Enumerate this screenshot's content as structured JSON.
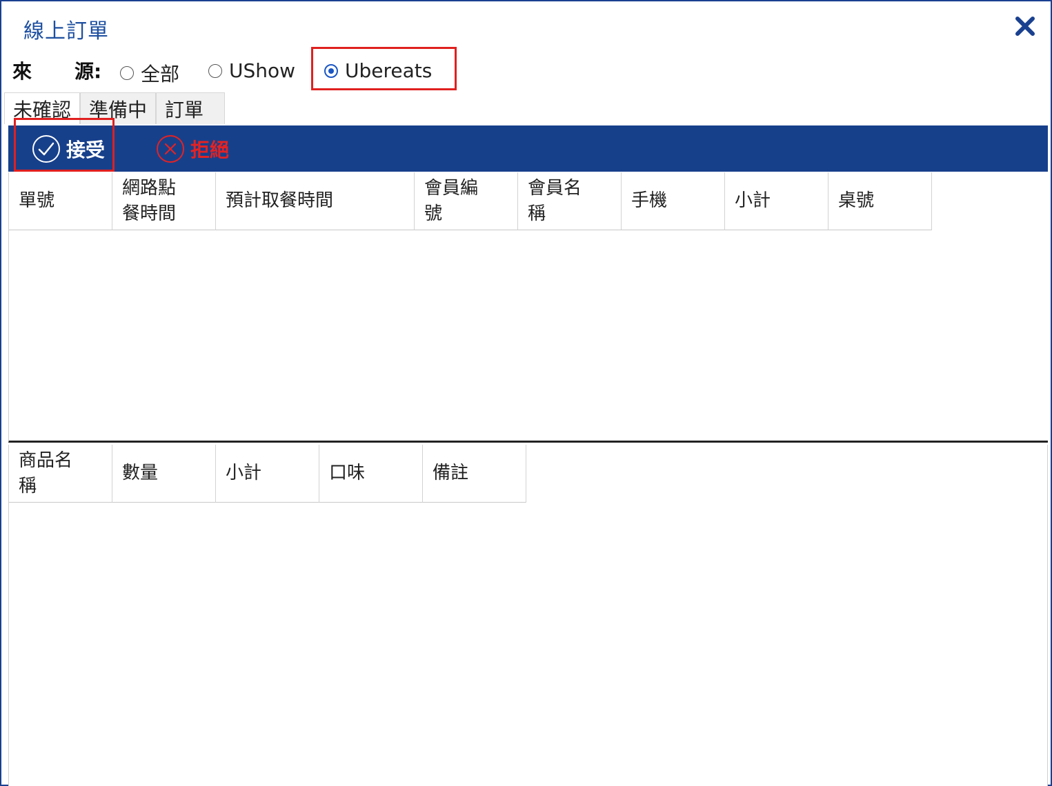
{
  "window": {
    "title": "線上訂單"
  },
  "source": {
    "label_char1": "來",
    "label_char2": "源:",
    "options": [
      {
        "label": "全部",
        "checked": false
      },
      {
        "label": "UShow",
        "checked": false
      },
      {
        "label": "Ubereats",
        "checked": true
      }
    ]
  },
  "tabs": [
    {
      "label": "未確認",
      "active": true
    },
    {
      "label": "準備中",
      "active": false
    },
    {
      "label": "訂單",
      "active": false
    }
  ],
  "toolbar": {
    "accept_label": "接受",
    "reject_label": "拒絕"
  },
  "orders_table": {
    "columns": [
      "單號",
      "網路點\n餐時間",
      "預計取餐時間",
      "會員編\n號",
      "會員名\n稱",
      "手機",
      "小計",
      "桌號"
    ],
    "rows": []
  },
  "items_table": {
    "columns": [
      "商品名\n稱",
      "數量",
      "小計",
      "口味",
      "備註"
    ],
    "rows": []
  },
  "colors": {
    "accent": "#17408b",
    "title": "#1d4fa0",
    "highlight": "#e0201f",
    "reject": "#e52222"
  },
  "icons": [
    "close-icon",
    "check-circle-icon",
    "x-circle-icon"
  ]
}
